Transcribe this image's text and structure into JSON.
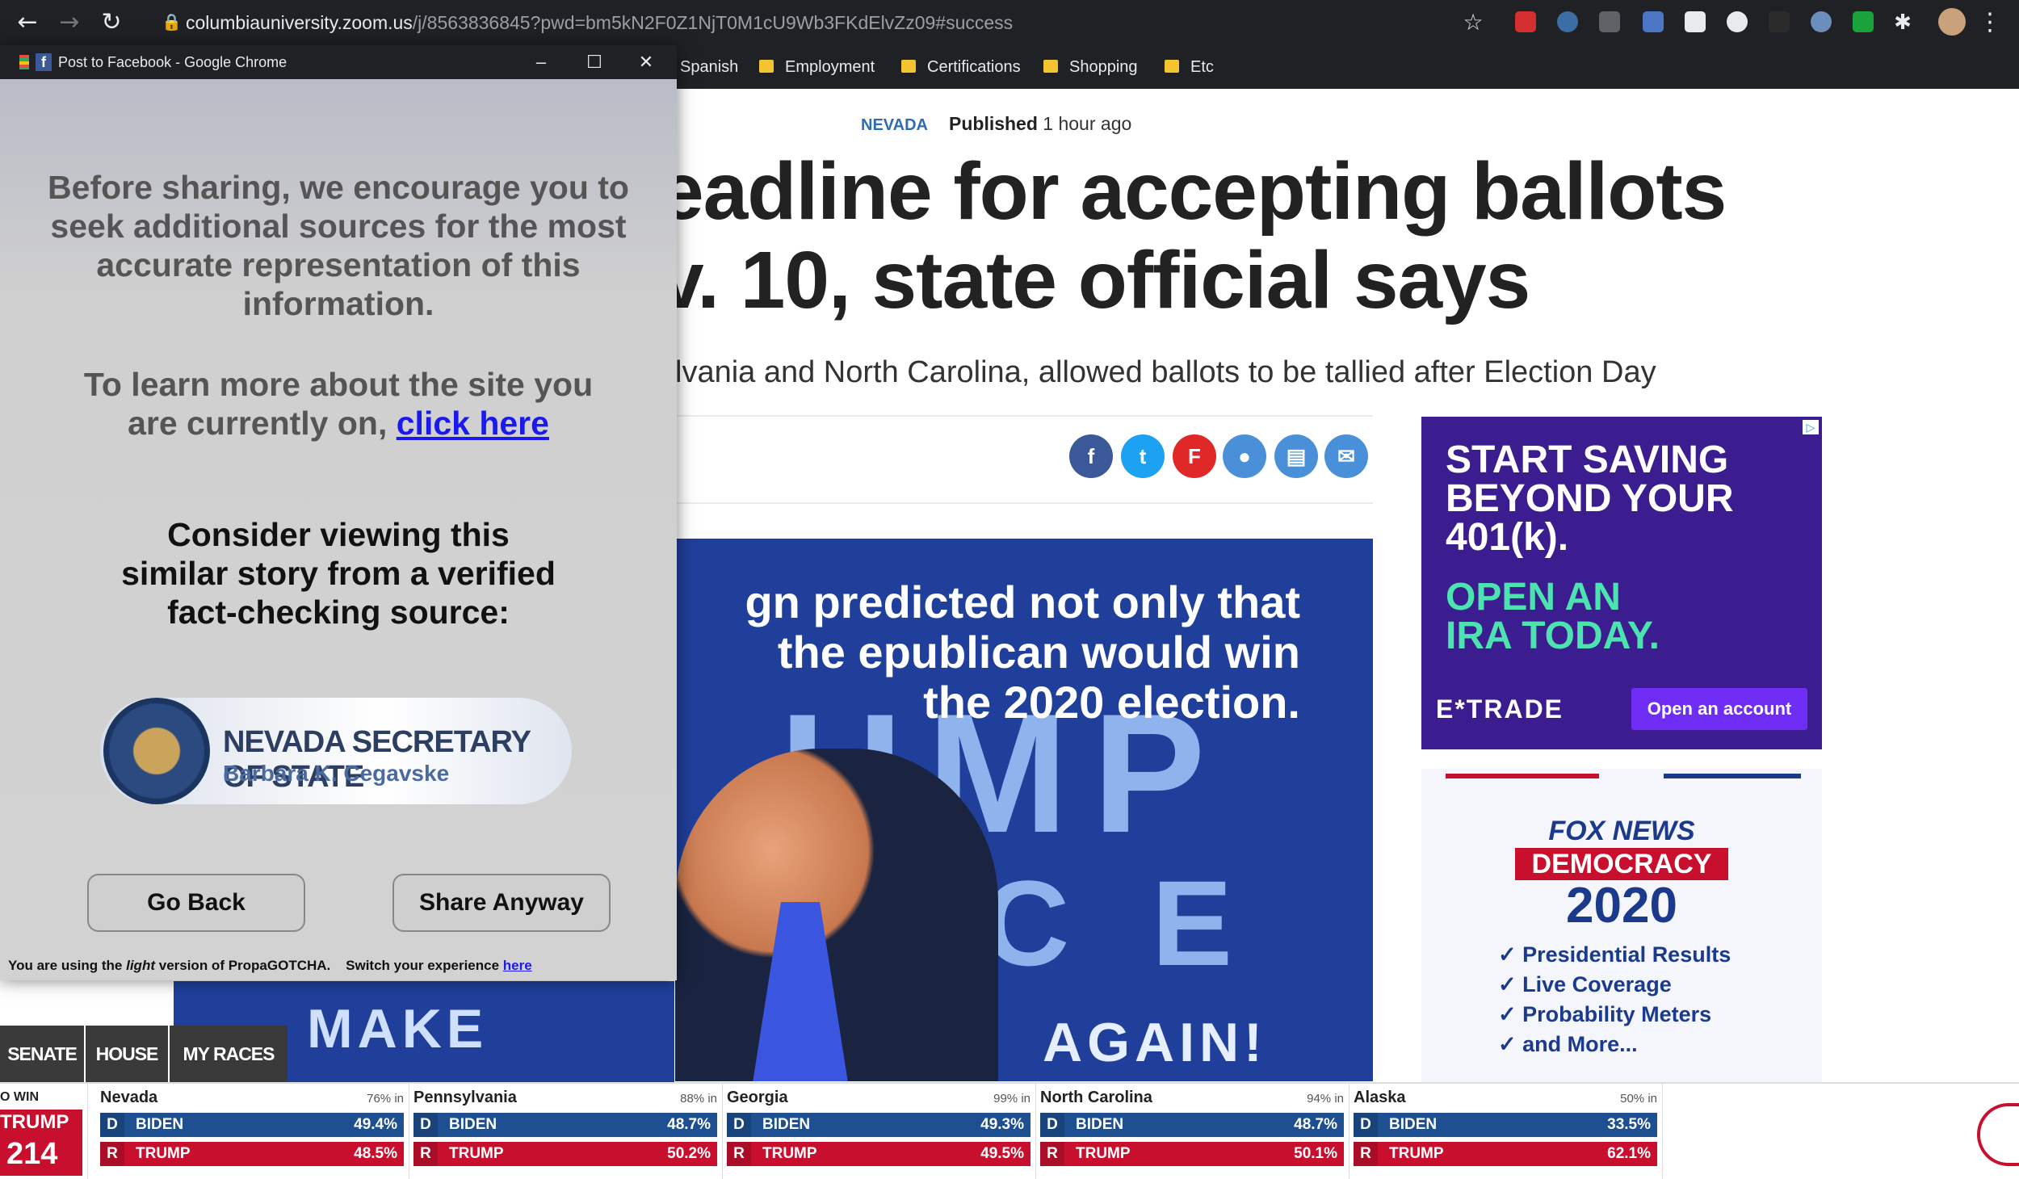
{
  "browser": {
    "url_host": "columbiauniversity.zoom.us",
    "url_path": "/j/8563836845?pwd=bm5kN2F0Z1NjT0M1cU9Wb3FKdElvZz09#success",
    "bookmarks": [
      "Spanish",
      "Employment",
      "Certifications",
      "Shopping",
      "Etc"
    ]
  },
  "popup": {
    "window_title": "Post to Facebook - Google Chrome",
    "message1": "Before sharing, we encourage you to seek additional sources for the most accurate representation of this information.",
    "message2_prefix": "To learn more about the site you are currently on,",
    "message2_link": "click here",
    "message3": "Consider viewing this similar story from a verified fact-checking source:",
    "source_name": "NEVADA SECRETARY OF STATE",
    "source_person": "Barbara K. Cegavske",
    "go_back": "Go Back",
    "share_anyway": "Share Anyway",
    "footnote_prefix": "You are using the",
    "footnote_light": "light",
    "footnote_mid": "version of PropaGOTCHA.    Switch your experience",
    "footnote_link": "here"
  },
  "article": {
    "category": "NEVADA",
    "published_label": "Published",
    "published_time": "1 hour ago",
    "headline_line1": "eadline for accepting ballots",
    "headline_line2": "v. 10, state official says",
    "subhead": "lvania and North Carolina, allowed ballots to be tallied after Election Day",
    "photo_caption": "gn predicted not only that the epublican would win the 2020 election.",
    "photo_letters": "UMP",
    "photo_letters2": "C E",
    "photo_bottom": "AGAIN!",
    "photo_left": "MAKE"
  },
  "ads": {
    "etrade_line1": "START SAVING BEYOND YOUR 401(k).",
    "etrade_line2": "OPEN AN IRA TODAY.",
    "etrade_logo": "E*TRADE",
    "etrade_button": "Open an account",
    "fox_brand": "FOX NEWS",
    "fox_demo": "DEMOCRACY",
    "fox_year": "2020",
    "fox_items": [
      "Presidential Results",
      "Live Coverage",
      "Probability Meters",
      "and More..."
    ]
  },
  "tabs": [
    "SENATE",
    "HOUSE",
    "MY RACES"
  ],
  "ticker": {
    "left_label": "O WIN",
    "left_name": "TRUMP",
    "left_count": "214",
    "states": [
      {
        "name": "Nevada",
        "pct": "76% in",
        "biden": "49.4%",
        "trump": "48.5%"
      },
      {
        "name": "Pennsylvania",
        "pct": "88% in",
        "biden": "48.7%",
        "trump": "50.2%"
      },
      {
        "name": "Georgia",
        "pct": "99% in",
        "biden": "49.3%",
        "trump": "49.5%"
      },
      {
        "name": "North Carolina",
        "pct": "94% in",
        "biden": "48.7%",
        "trump": "50.1%"
      },
      {
        "name": "Alaska",
        "pct": "50% in",
        "biden": "33.5%",
        "trump": "62.1%"
      }
    ],
    "d": "D",
    "r": "R",
    "biden_label": "BIDEN",
    "trump_label": "TRUMP"
  }
}
